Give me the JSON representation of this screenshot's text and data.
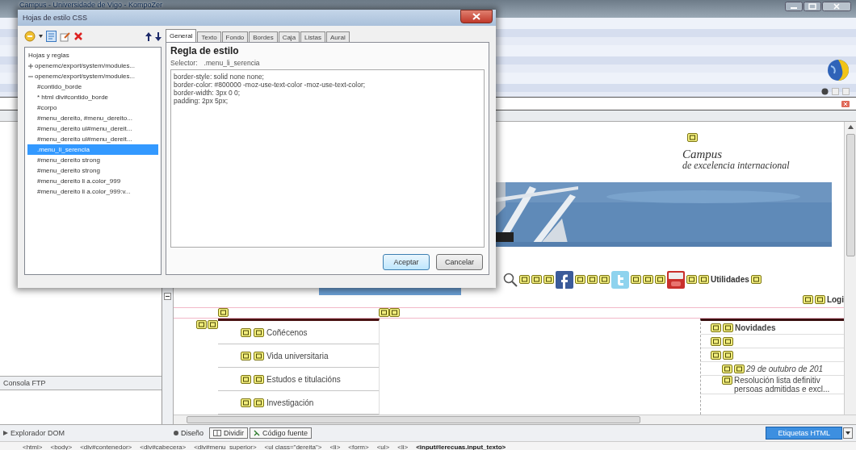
{
  "window": {
    "title": "Campus - Universidade de Vigo - KompoZer"
  },
  "stylesheet_dialog": {
    "title": "Hojas de estilo CSS",
    "tree_header": "Hojas y reglas",
    "tree": [
      {
        "label": "openemc/export/system/modules...",
        "expanded": false,
        "selected": false
      },
      {
        "label": "openemc/export/system/modules...",
        "expanded": true,
        "selected": false,
        "children": [
          {
            "label": "#contido_borde",
            "selected": false
          },
          {
            "label": "* html div#contido_borde",
            "selected": false
          },
          {
            "label": "#corpo",
            "selected": false
          },
          {
            "label": "#menu_dereito, #menu_dereito...",
            "selected": false
          },
          {
            "label": "#menu_dereito ul#menu_dereit...",
            "selected": false
          },
          {
            "label": "#menu_dereito ul#menu_dereit...",
            "selected": false
          },
          {
            "label": ".menu_li_serencia",
            "selected": true
          },
          {
            "label": "#menu_dereito strong",
            "selected": false
          },
          {
            "label": "#menu_dereito strong",
            "selected": false
          },
          {
            "label": "#menu_dereito li a.color_999",
            "selected": false
          },
          {
            "label": "#menu_dereito li a.color_999:v...",
            "selected": false
          }
        ]
      }
    ],
    "tabs": [
      {
        "label": "General",
        "selected": true
      },
      {
        "label": "Texto",
        "selected": false
      },
      {
        "label": "Fondo",
        "selected": false
      },
      {
        "label": "Bordes",
        "selected": false
      },
      {
        "label": "Caja",
        "selected": false
      },
      {
        "label": "Listas",
        "selected": false
      },
      {
        "label": "Aural",
        "selected": false
      }
    ],
    "rule_heading": "Regla de estilo",
    "selector_label": "Selector:",
    "selector": ".menu_li_serencia",
    "declarations": [
      "border-style: solid none none;",
      "border-color: #800000 -moz-use-text-color -moz-use-text-color;",
      "border-width: 3px 0 0;",
      "padding: 2px 5px;"
    ],
    "buttons": [
      "Aceptar",
      "Cancelar"
    ]
  },
  "left_panel": {
    "ftp_label": "Consola FTP",
    "dom_label": "Explorador DOM"
  },
  "editor": {
    "campus_lines": [
      "Campus",
      "de excelencia internacional"
    ],
    "social": [
      {
        "kind": "facebook"
      },
      {
        "kind": "twitter"
      },
      {
        "kind": "youtube"
      }
    ],
    "utilities_link": "Utilidades",
    "login_link": "Logi",
    "menu": [
      "Coñécenos",
      "Vida universitaria",
      "Estudos e titulacións",
      "Investigación"
    ],
    "news": {
      "heading": "Novidades",
      "date": "29 de outubro de 201",
      "lines": [
        "Resolución lista definitiv",
        "persoas admitidas e excl..."
      ]
    }
  },
  "mode_tabs": [
    {
      "label": "Diseño",
      "selected": true
    },
    {
      "label": "Dividir",
      "selected": false
    },
    {
      "label": "Código fuente",
      "selected": false
    }
  ],
  "tags_button": "Etiquetas HTML",
  "status_path": [
    "<html>",
    "<body>",
    "<div#contenedor>",
    "<div#cabecera>",
    "<div#menu_superior>",
    "<ul class=\"dereita\">",
    "<li>",
    "<form>",
    "<ul>",
    "<li>",
    "<input#lerecuas.input_texto>"
  ]
}
